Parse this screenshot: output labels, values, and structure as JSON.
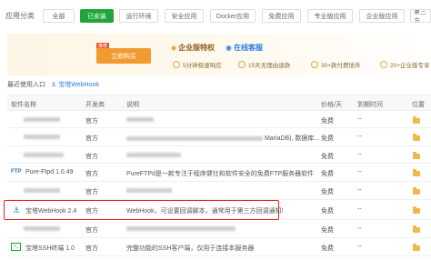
{
  "category": {
    "label": "应用分类",
    "buttons": [
      {
        "label": "全部",
        "active": false
      },
      {
        "label": "已安装",
        "active": true
      },
      {
        "label": "运行环境",
        "active": false
      },
      {
        "label": "安全应用",
        "active": false
      },
      {
        "label": "Docker应用",
        "active": false
      },
      {
        "label": "免费应用",
        "active": false
      },
      {
        "label": "专业版应用",
        "active": false
      },
      {
        "label": "企业版应用",
        "active": false
      },
      {
        "label": "第三方",
        "active": false
      }
    ]
  },
  "banner": {
    "buy_tag": "推荐",
    "buy_label": "立即购买",
    "enterprise_title": "企业版特权",
    "online_title": "在线客服",
    "features": [
      "5分钟极速响应",
      "15天无理由退款",
      "30+款付费插件",
      "20+企业版专享"
    ]
  },
  "recent": {
    "label": "最近使用入口",
    "link": "宝塔WebHook"
  },
  "table": {
    "headers": [
      "软件名称",
      "开发商",
      "说明",
      "价格/天",
      "到期时间",
      "位置"
    ],
    "rows": [
      {
        "name": "",
        "vendor": "官方",
        "desc": "",
        "price": "免费",
        "expiry": "--"
      },
      {
        "name": "",
        "vendor": "官方",
        "desc": "MariaDB), 数据库...",
        "price": "免费",
        "expiry": "--"
      },
      {
        "name": "",
        "vendor": "官方",
        "desc": "",
        "price": "免费",
        "expiry": "--"
      },
      {
        "name": "Pure-Ftpd 1.0.49",
        "vendor": "官方",
        "desc": "PureFTPd是一款专注于程序健壮和软件安全的免费FTP服务器软件",
        "price": "免费",
        "expiry": "--"
      },
      {
        "name": "",
        "vendor": "官方",
        "desc": "",
        "price": "免费",
        "expiry": "--"
      },
      {
        "name": "宝塔WebHook 2.4",
        "vendor": "官方",
        "desc": "WebHook，可设置回调脚本，通常用于第三方回调通知!",
        "price": "免费",
        "expiry": "--"
      },
      {
        "name": "",
        "vendor": "官方",
        "desc": "",
        "price": "免费",
        "expiry": "--"
      },
      {
        "name": "宝塔SSH终端 1.0",
        "vendor": "官方",
        "desc": "完整功能的SSH客户端，仅用于连接本服务器",
        "price": "免费",
        "expiry": "--"
      }
    ]
  },
  "colors": {
    "accent": "#20a53a",
    "highlight": "#e0241b",
    "link": "#2b7de0"
  }
}
